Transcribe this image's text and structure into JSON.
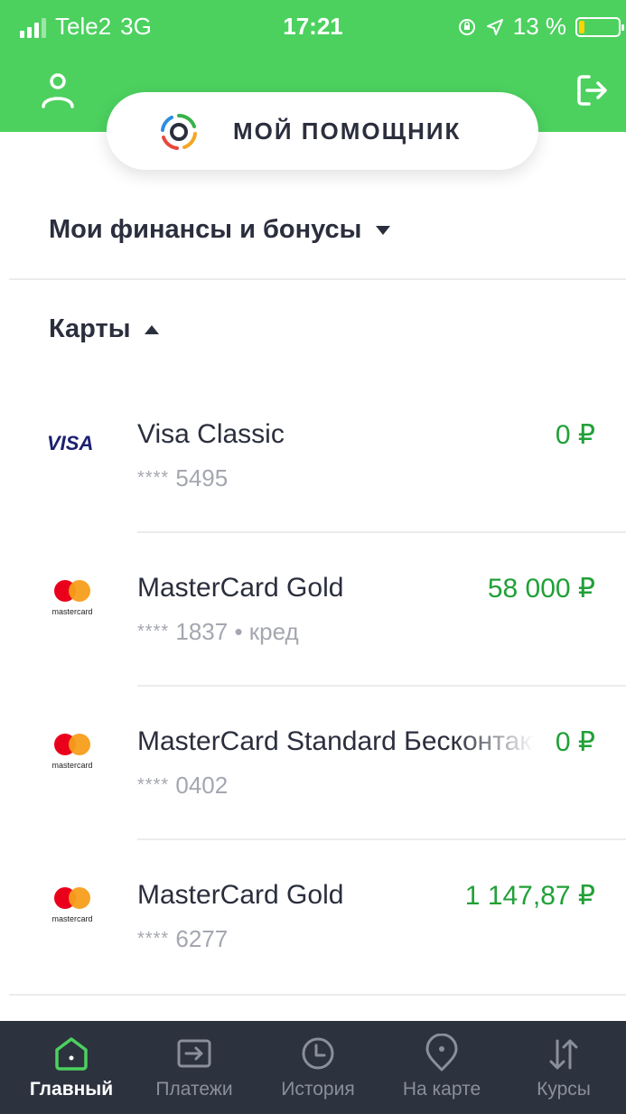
{
  "status": {
    "carrier": "Tele2",
    "network": "3G",
    "time": "17:21",
    "battery": "13 %",
    "battery_color": "#ffd400"
  },
  "theme": {
    "header_color": "#4cd15f",
    "amount_color": "#21a038",
    "tabbar_color": "#2d323f"
  },
  "header": {
    "profile_icon": "user-icon",
    "exit_icon": "logout-icon"
  },
  "assistant": {
    "label": "МОЙ ПОМОЩНИК",
    "icon": "assistant-logo-icon"
  },
  "finances": {
    "title": "Мои финансы и бонусы"
  },
  "cards": {
    "title": "Карты",
    "items": [
      {
        "logo": "visa",
        "name": "Visa Classic",
        "number_mask": "****",
        "number": "5495",
        "extra": "",
        "amount": "0 ₽"
      },
      {
        "logo": "mastercard",
        "name": "MasterCard Gold",
        "number_mask": "****",
        "number": "1837",
        "extra": "кред",
        "amount": "58 000 ₽"
      },
      {
        "logo": "mastercard",
        "name": "MasterCard Standard Бесконтактная",
        "number_mask": "****",
        "number": "0402",
        "extra": "",
        "amount": "0 ₽"
      },
      {
        "logo": "mastercard",
        "name": "MasterCard Gold",
        "number_mask": "****",
        "number": "6277",
        "extra": "",
        "amount": "1 147,87 ₽"
      }
    ],
    "visa_label": "VISA",
    "mastercard_label": "mastercard"
  },
  "tabs": [
    {
      "label": "Главный",
      "icon": "home-icon",
      "active": true
    },
    {
      "label": "Платежи",
      "icon": "payments-icon",
      "active": false
    },
    {
      "label": "История",
      "icon": "clock-icon",
      "active": false
    },
    {
      "label": "На карте",
      "icon": "map-pin-icon",
      "active": false
    },
    {
      "label": "Курсы",
      "icon": "exchange-arrows-icon",
      "active": false
    }
  ]
}
